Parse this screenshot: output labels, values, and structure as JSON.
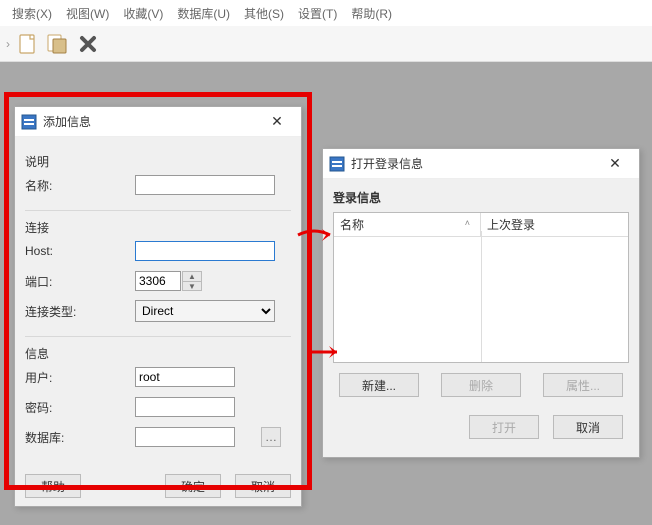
{
  "menubar": {
    "search": "搜索(X)",
    "view": "视图(W)",
    "favorites": "收藏(V)",
    "database": "数据库(U)",
    "other": "其他(S)",
    "settings": "设置(T)",
    "help": "帮助(R)"
  },
  "dlg_add": {
    "title": "添加信息",
    "section_desc": "说明",
    "label_name": "名称:",
    "name_value": "",
    "section_conn": "连接",
    "label_host": "Host:",
    "host_value": "",
    "label_port": "端口:",
    "port_value": "3306",
    "label_conntype": "连接类型:",
    "conntype_value": "Direct",
    "section_info": "信息",
    "label_user": "用户:",
    "user_value": "root",
    "label_password": "密码:",
    "password_value": "",
    "label_database": "数据库:",
    "database_value": "",
    "btn_help": "帮助",
    "btn_ok": "确定",
    "btn_cancel": "取消"
  },
  "dlg_open": {
    "title": "打开登录信息",
    "group_label": "登录信息",
    "col_name": "名称",
    "col_lastlogin": "上次登录",
    "btn_new": "新建...",
    "btn_delete": "删除",
    "btn_props": "属性...",
    "btn_open": "打开",
    "btn_cancel": "取消"
  }
}
